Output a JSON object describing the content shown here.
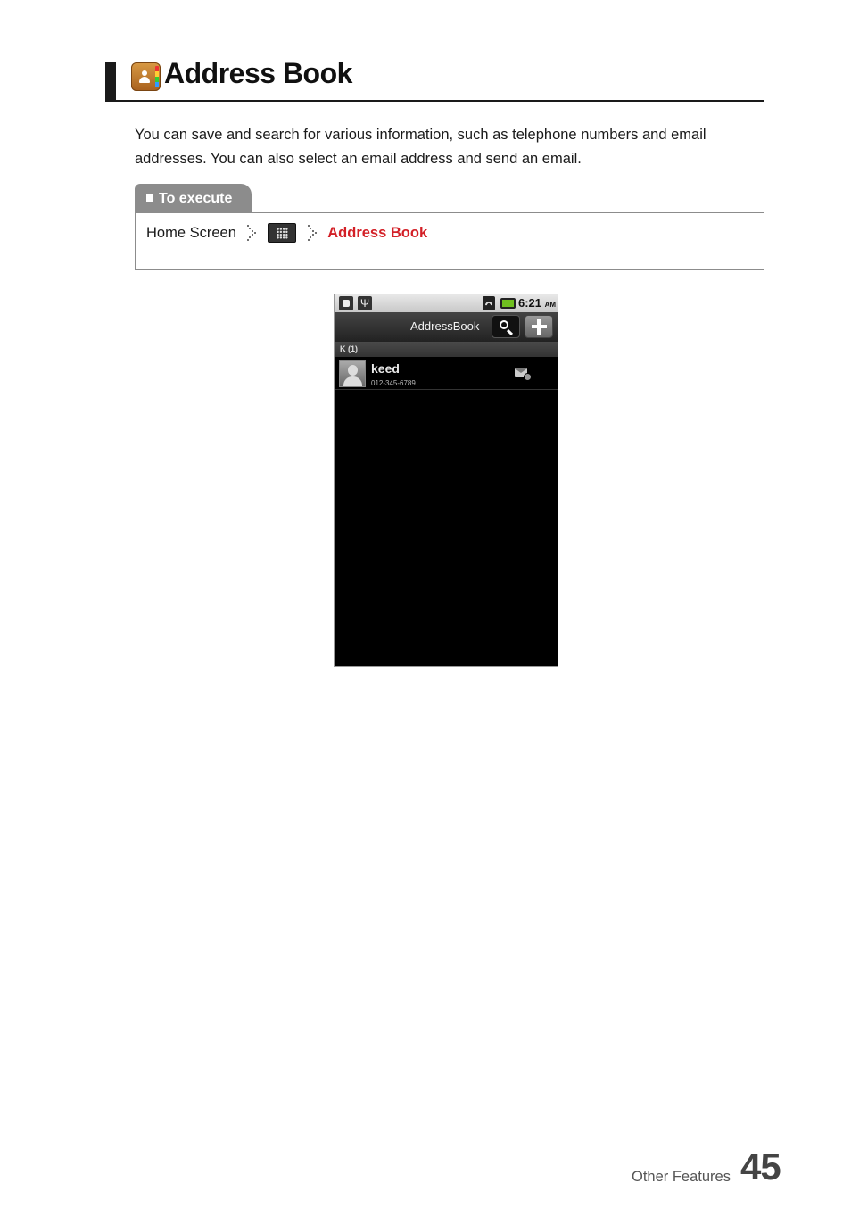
{
  "heading": {
    "title": "Address Book",
    "icon": "address-book-app-icon"
  },
  "intro": "You can save and search for various information, such as telephone numbers and email addresses. You can also select an email address and send an email.",
  "execute": {
    "tab_label": "To execute",
    "step1": "Home Screen",
    "step2_icon": "app-drawer-grid-icon",
    "step3": "Address Book",
    "highlight_color": "#d32027"
  },
  "phone": {
    "status_bar": {
      "time": "6:21",
      "ampm": "AM"
    },
    "top_bar": {
      "title": "AddressBook"
    },
    "section": {
      "label": "K  (1)"
    },
    "contacts": [
      {
        "name": "keed",
        "phone": "012-345-6789"
      }
    ]
  },
  "footer": {
    "section": "Other Features",
    "page": "45"
  }
}
